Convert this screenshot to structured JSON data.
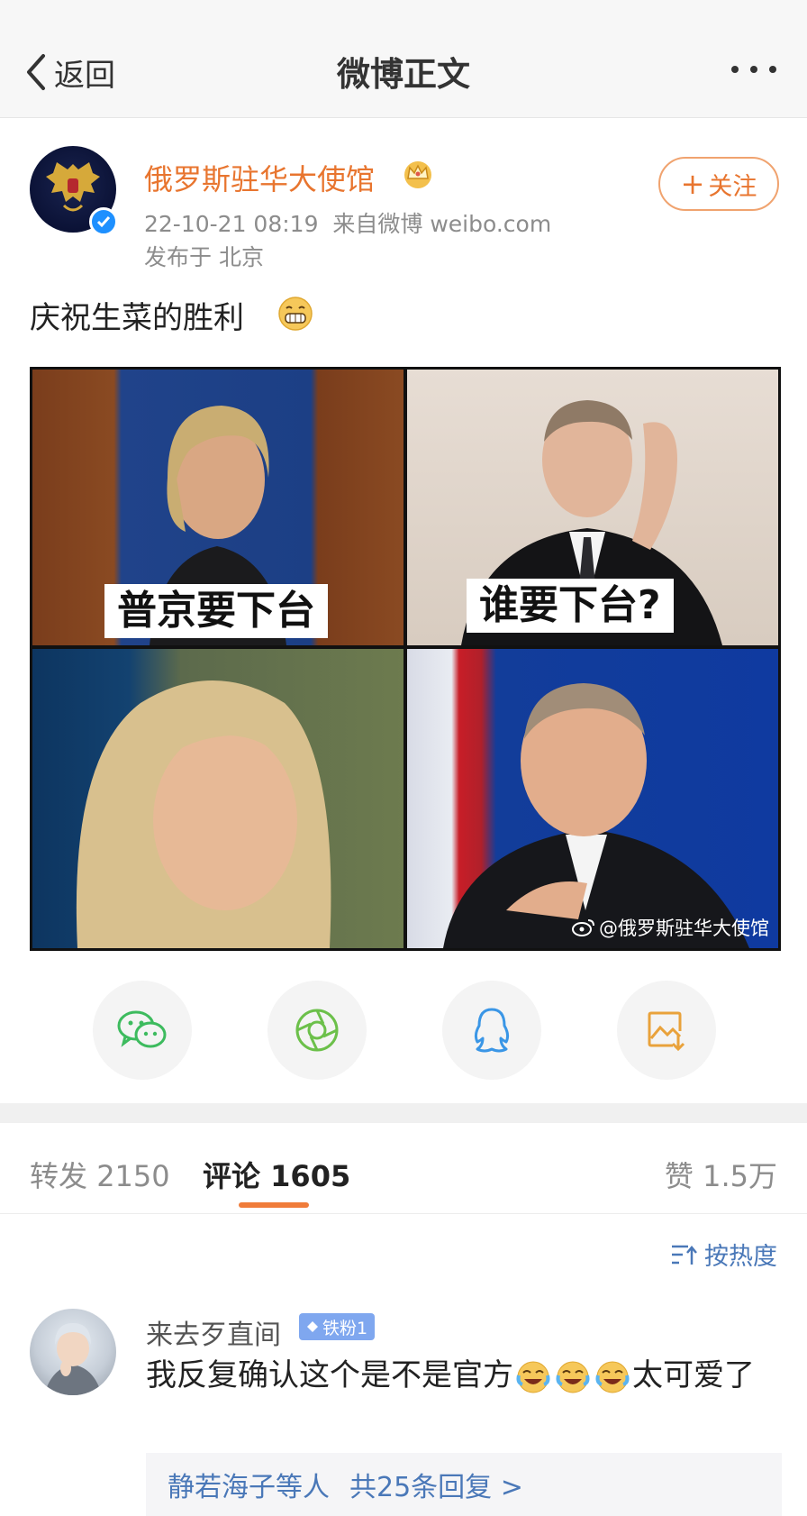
{
  "navbar": {
    "back_label": "返回",
    "title": "微博正文"
  },
  "post": {
    "author_name": "俄罗斯驻华大使馆",
    "timestamp": "22-10-21 08:19",
    "source": "来自微博 weibo.com",
    "location": "发布于 北京",
    "follow_label": "关注",
    "text": "庆祝生菜的胜利",
    "image": {
      "caption_left": "普京要下台",
      "caption_right": "谁要下台?",
      "watermark": "@俄罗斯驻华大使馆"
    }
  },
  "share": {
    "items": [
      {
        "icon": "wechat-icon"
      },
      {
        "icon": "moments-icon"
      },
      {
        "icon": "qq-icon"
      },
      {
        "icon": "save-image-icon"
      }
    ]
  },
  "tabs": {
    "repost_label": "转发",
    "repost_count": "2150",
    "comments_label": "评论",
    "comments_count": "1605",
    "likes_label": "赞",
    "likes_count": "1.5万"
  },
  "sort": {
    "label": "按热度"
  },
  "comments": [
    {
      "name": "来去歹直间",
      "badge": "铁粉1",
      "text_before": "我反复确认这个是不是官方",
      "text_after": "太可爱了",
      "replies_users": "静若海子等人",
      "replies_count": "共25条回复 >"
    }
  ],
  "colors": {
    "accent_orange": "#e8752f",
    "link_blue": "#4a78b8",
    "badge_blue": "#7fa7ef"
  }
}
